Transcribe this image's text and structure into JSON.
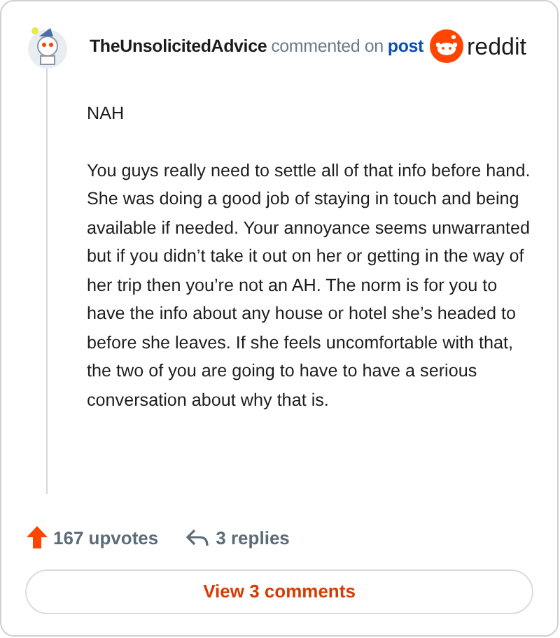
{
  "comment": {
    "author": "TheUnsolicitedAdvice",
    "action": "commented on",
    "link": "post",
    "brand": "reddit",
    "paragraphs": [
      "NAH",
      "You guys really need to settle all of that info before hand. She was doing a good job of staying in touch and being available if needed. Your annoyance seems unwarranted but if you didn’t take it out on her or getting in the way of her trip then you’re not an AH. The norm is for you to have the info about any house or hotel she’s headed to before she leaves. If she feels uncomfortable with that, the two of you are going to have to have a serious conversation about why that is."
    ]
  },
  "stats": {
    "upvotes": "167 upvotes",
    "replies": "3 replies"
  },
  "button": "View 3 comments"
}
